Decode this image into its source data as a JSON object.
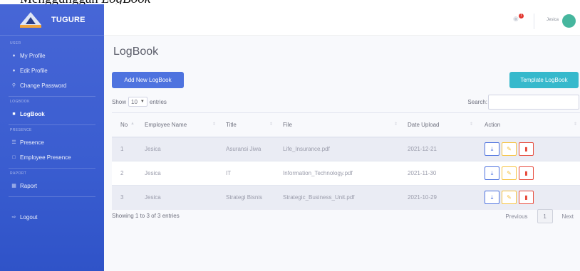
{
  "caption": {
    "prefix": "Menggunggah",
    "italic": "LogBook"
  },
  "brand": {
    "name": "TUGURE"
  },
  "sidebar": {
    "sections": [
      {
        "label": "USER",
        "items": [
          {
            "label": "My Profile",
            "icon": "user-icon"
          },
          {
            "label": "Edit Profile",
            "icon": "user-edit-icon"
          },
          {
            "label": "Change Password",
            "icon": "key-icon"
          }
        ]
      },
      {
        "label": "LOGBOOK",
        "items": [
          {
            "label": "LogBook",
            "icon": "book-icon",
            "active": true
          }
        ]
      },
      {
        "label": "PRESENCE",
        "items": [
          {
            "label": "Presence",
            "icon": "list-icon"
          },
          {
            "label": "Employee Presence",
            "icon": "calendar-icon"
          }
        ]
      },
      {
        "label": "RAPORT",
        "items": [
          {
            "label": "Raport",
            "icon": "chart-icon"
          }
        ]
      }
    ],
    "logout": "Logout"
  },
  "topbar": {
    "user_name": "Jesica",
    "alert_count": "1"
  },
  "page": {
    "title": "LogBook",
    "add_button": "Add New LogBook",
    "template_button": "Template LogBook",
    "show_label": "Show",
    "entries_value": "10",
    "entries_label": "entries",
    "search_label": "Search:"
  },
  "table": {
    "headers": [
      "No",
      "Employee Name",
      "Title",
      "File",
      "Date Upload",
      "Action"
    ],
    "rows": [
      [
        "1",
        "Jesica",
        "Asuransi Jiwa",
        "Life_Insurance.pdf",
        "2021-12-21"
      ],
      [
        "2",
        "Jesica",
        "IT",
        "Information_Technology.pdf",
        "2021-11-30"
      ],
      [
        "3",
        "Jesica",
        "Strategi Bisnis",
        "Strategic_Business_Unit.pdf",
        "2021-10-29"
      ]
    ]
  },
  "footer": {
    "showing": "Showing 1 to 3 of 3 entries",
    "previous": "Previous",
    "page": "1",
    "next": "Next"
  },
  "colors": {
    "primary": "#4e73df",
    "info": "#36b9cc",
    "warning": "#f6c23e",
    "danger": "#e74a3b"
  }
}
